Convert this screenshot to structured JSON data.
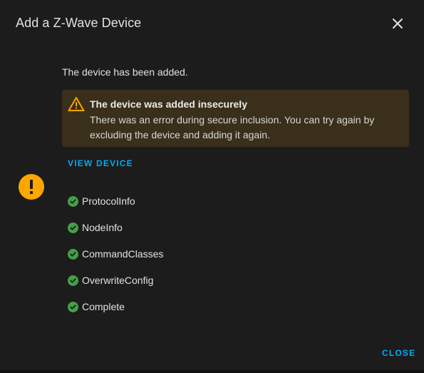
{
  "dialog": {
    "title": "Add a Z-Wave Device",
    "close_icon": "close-icon",
    "status_icon": "exclamation-icon",
    "message": "The device has been added.",
    "alert": {
      "icon": "warning-triangle-icon",
      "title": "The device was added insecurely",
      "body": "There was an error during secure inclusion. You can try again by excluding the device and adding it again."
    },
    "view_device_label": "VIEW DEVICE",
    "steps": [
      {
        "label": "ProtocolInfo",
        "status": "complete"
      },
      {
        "label": "NodeInfo",
        "status": "complete"
      },
      {
        "label": "CommandClasses",
        "status": "complete"
      },
      {
        "label": "OverwriteConfig",
        "status": "complete"
      },
      {
        "label": "Complete",
        "status": "complete"
      }
    ],
    "close_label": "CLOSE"
  },
  "colors": {
    "background": "#1c1c1c",
    "accent": "#03a9f4",
    "warning": "#ffa600",
    "alert_bg": "#3a2f1a",
    "success": "#43a047"
  }
}
